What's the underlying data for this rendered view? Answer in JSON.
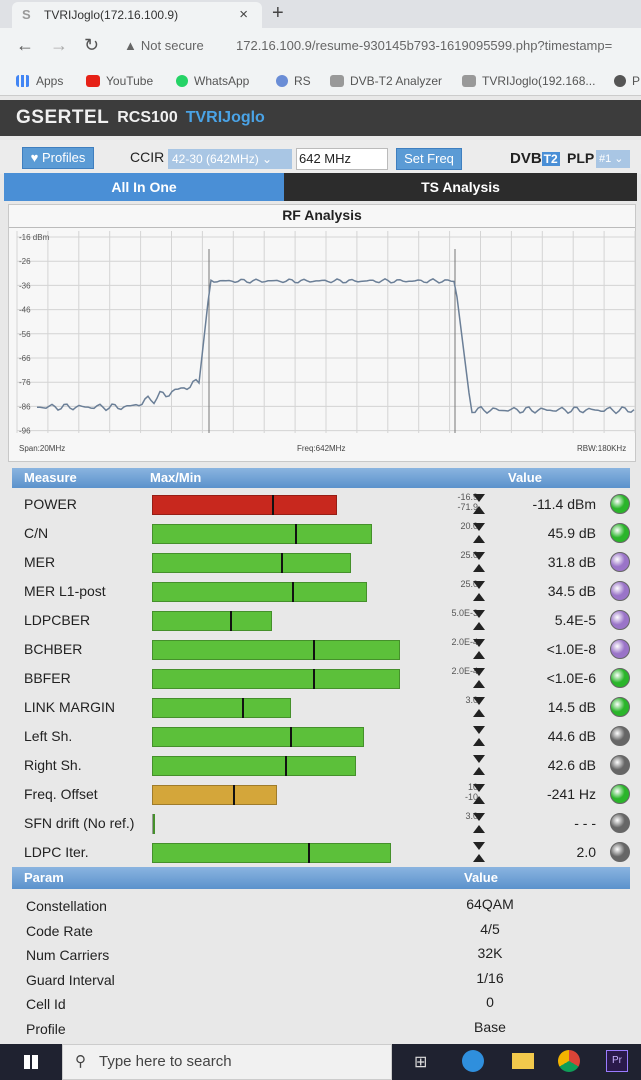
{
  "browser": {
    "tab_title": "TVRIJoglo(172.16.100.9)",
    "tab_close": "×",
    "new_tab": "+",
    "security": "Not secure",
    "url": "172.16.100.9/resume-930145b793-1619095599.php?timestamp=",
    "bookmarks": [
      "Apps",
      "YouTube",
      "WhatsApp",
      "RS",
      "DVB-T2 Analyzer",
      "TVRIJoglo(192.168...",
      "P"
    ]
  },
  "app": {
    "brand": "GSERTEL",
    "model": "RCS100",
    "station": "TVRIJoglo",
    "profiles_label": "Profiles",
    "standard_label": "CCIR",
    "channel_value": "42-30 (642MHz)",
    "freq_value": "642 MHz",
    "setfreq_label": "Set Freq",
    "dvb_label": "DVB",
    "dvb_t2": "T2",
    "plp_label": "PLP",
    "plp_value": "#1",
    "tab_allinone": "All In One",
    "tab_ts": "TS Analysis"
  },
  "rf": {
    "title": "RF Analysis",
    "y_ticks": [
      "-16 dBm",
      "-26",
      "-36",
      "-46",
      "-56",
      "-66",
      "-76",
      "-86",
      "-96"
    ],
    "span": "Span:20MHz",
    "freq": "Freq:642MHz",
    "rbw": "RBW:180KHz"
  },
  "measure_header": {
    "measure": "Measure",
    "maxmin": "Max/Min",
    "value": "Value"
  },
  "measures": [
    {
      "name": "POWER",
      "lim1": "-16.9",
      "lim2": "-71.9",
      "value": "-11.4 dBm",
      "fill": 0.68,
      "barcolor": "#c8281e",
      "dot": "#2bb52b"
    },
    {
      "name": "C/N",
      "lim1": "20.0",
      "lim2": "",
      "value": "45.9 dB",
      "fill": 0.81,
      "barcolor": "#5cc03a",
      "dot": "#2bb52b"
    },
    {
      "name": "MER",
      "lim1": "25.0",
      "lim2": "",
      "value": "31.8 dB",
      "fill": 0.73,
      "barcolor": "#5cc03a",
      "dot": "#9a74c8"
    },
    {
      "name": "MER L1-post",
      "lim1": "25.0",
      "lim2": "",
      "value": "34.5 dB",
      "fill": 0.79,
      "barcolor": "#5cc03a",
      "dot": "#9a74c8"
    },
    {
      "name": "LDPCBER",
      "lim1": "5.0E-3",
      "lim2": "",
      "value": "5.4E-5",
      "fill": 0.44,
      "barcolor": "#5cc03a",
      "dot": "#9a74c8"
    },
    {
      "name": "BCHBER",
      "lim1": "2.0E-4",
      "lim2": "",
      "value": "<1.0E-8",
      "fill": 0.91,
      "barcolor": "#5cc03a",
      "dot": "#9a74c8"
    },
    {
      "name": "BBFER",
      "lim1": "2.0E-4",
      "lim2": "",
      "value": "<1.0E-6",
      "fill": 0.91,
      "barcolor": "#5cc03a",
      "dot": "#2bb52b"
    },
    {
      "name": "LINK MARGIN",
      "lim1": "3.0",
      "lim2": "",
      "value": "14.5 dB",
      "fill": 0.51,
      "barcolor": "#5cc03a",
      "dot": "#2bb52b"
    },
    {
      "name": "Left Sh.",
      "lim1": "",
      "lim2": "",
      "value": "44.6 dB",
      "fill": 0.78,
      "barcolor": "#5cc03a",
      "dot": "#666666"
    },
    {
      "name": "Right Sh.",
      "lim1": "",
      "lim2": "",
      "value": "42.6 dB",
      "fill": 0.75,
      "barcolor": "#5cc03a",
      "dot": "#666666"
    },
    {
      "name": "Freq. Offset",
      "lim1": "10",
      "lim2": "-10",
      "value": "-241 Hz",
      "fill": 0.46,
      "barcolor": "#d4a63a",
      "dot": "#2bb52b"
    },
    {
      "name": "SFN drift (No ref.)",
      "lim1": "3.0",
      "lim2": "",
      "value": "- - -",
      "fill": 0.0,
      "barcolor": "#5cc03a",
      "dot": "#666666"
    },
    {
      "name": "LDPC Iter.",
      "lim1": "",
      "lim2": "",
      "value": "2.0",
      "fill": 0.88,
      "barcolor": "#5cc03a",
      "dot": "#666666"
    }
  ],
  "param_header": {
    "param": "Param",
    "value": "Value"
  },
  "params": [
    {
      "name": "Constellation",
      "value": "64QAM"
    },
    {
      "name": "Code Rate",
      "value": "4/5"
    },
    {
      "name": "Num Carriers",
      "value": "32K"
    },
    {
      "name": "Guard Interval",
      "value": "1/16"
    },
    {
      "name": "Cell Id",
      "value": "0"
    },
    {
      "name": "Profile",
      "value": "Base"
    }
  ],
  "taskbar": {
    "search_placeholder": "Type here to search"
  }
}
